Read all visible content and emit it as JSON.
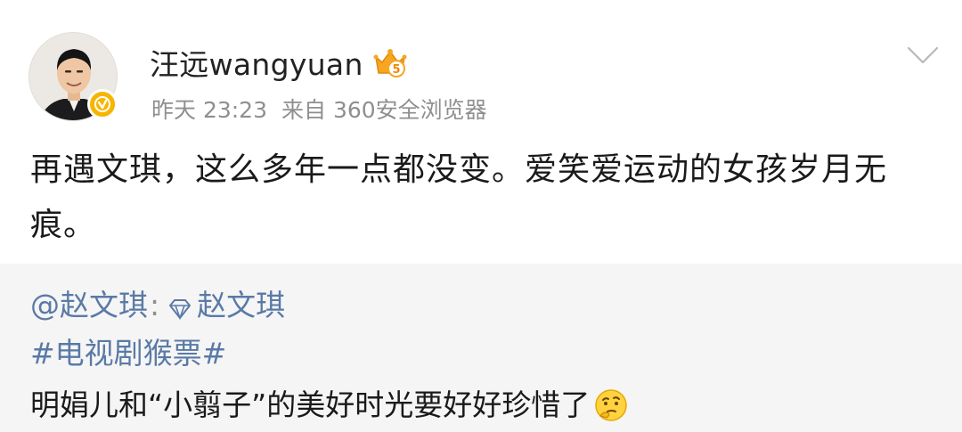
{
  "author": {
    "name": "汪远wangyuan",
    "avatar_icon": "user-avatar",
    "verified_icon": "verified-badge-icon",
    "vip_icon": "vip-crown-icon",
    "vip_level": "5"
  },
  "meta": {
    "time": "昨天 23:23",
    "source": "来自 360安全浏览器"
  },
  "menu_icon": "chevron-down-icon",
  "post_text": "再遇文琪，这么多年一点都没变。爱笑爱运动的女孩岁月无痕。",
  "repost": {
    "mention": "@赵文琪",
    "separator": ":",
    "linked_name": "赵文琪",
    "link_icon": "diamond-icon",
    "topic": "#电视剧猴票#",
    "text": "明娟儿和“小翦子”的美好时光要好好珍惜了",
    "emoji": "thinking-emoji-icon"
  },
  "colors": {
    "link": "#5a7aa6",
    "meta": "#8f8f8f",
    "repost_bg": "#f5f5f5",
    "badge": "#f7b500"
  }
}
